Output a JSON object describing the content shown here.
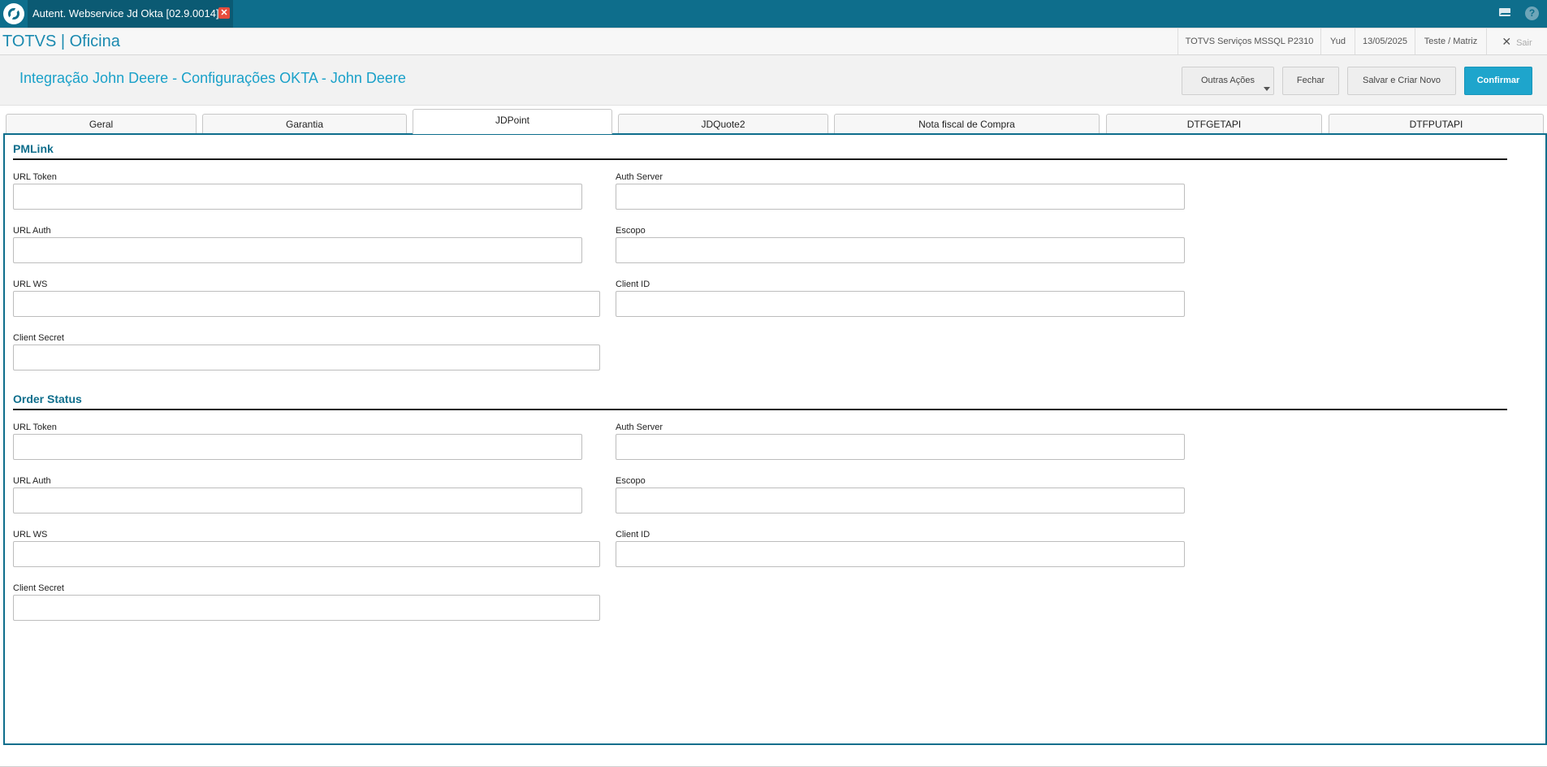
{
  "window": {
    "tab_label": "Autent. Webservice Jd Okta [02.9.0014]",
    "close_glyph": "✕",
    "help_glyph": "?"
  },
  "appbar": {
    "brand": "TOTVS | Oficina",
    "environment": "TOTVS Serviços MSSQL P2310",
    "user": "Yud",
    "date": "13/05/2025",
    "branch": "Teste / Matriz",
    "exit_label": "Sair",
    "exit_glyph": "✕"
  },
  "page": {
    "title": "Integração John Deere - Configurações OKTA - John Deere"
  },
  "actions": {
    "other": "Outras Ações",
    "close": "Fechar",
    "save_new": "Salvar e Criar Novo",
    "confirm": "Confirmar"
  },
  "tabs": {
    "geral": "Geral",
    "garantia": "Garantia",
    "jdpoint": "JDPoint",
    "jdquote2": "JDQuote2",
    "nota_fiscal": "Nota fiscal de Compra",
    "dtfgetapi": "DTFGETAPI",
    "dtfputapi": "DTFPUTAPI",
    "active": "JDPoint"
  },
  "sections": {
    "pmlink": {
      "title": "PMLink",
      "url_token": {
        "label": "URL Token",
        "value": ""
      },
      "auth_server": {
        "label": "Auth Server",
        "value": ""
      },
      "url_auth": {
        "label": "URL Auth",
        "value": ""
      },
      "escopo": {
        "label": "Escopo",
        "value": ""
      },
      "url_ws": {
        "label": "URL WS",
        "value": ""
      },
      "client_id": {
        "label": "Client ID",
        "value": ""
      },
      "client_secret": {
        "label": "Client Secret",
        "value": ""
      }
    },
    "order_status": {
      "title": "Order Status",
      "url_token": {
        "label": "URL Token",
        "value": ""
      },
      "auth_server": {
        "label": "Auth Server",
        "value": ""
      },
      "url_auth": {
        "label": "URL Auth",
        "value": ""
      },
      "escopo": {
        "label": "Escopo",
        "value": ""
      },
      "url_ws": {
        "label": "URL WS",
        "value": ""
      },
      "client_id": {
        "label": "Client ID",
        "value": ""
      },
      "client_secret": {
        "label": "Client Secret",
        "value": ""
      }
    }
  },
  "colors": {
    "titlebar": "#0e6e8c",
    "accent": "#1aa1c9",
    "primary_button": "#1ea5cc",
    "close_badge": "#e74c3c"
  },
  "icons": [
    "totvs-logo-icon",
    "close-icon",
    "mail-icon",
    "help-icon",
    "dropdown-caret-icon"
  ]
}
